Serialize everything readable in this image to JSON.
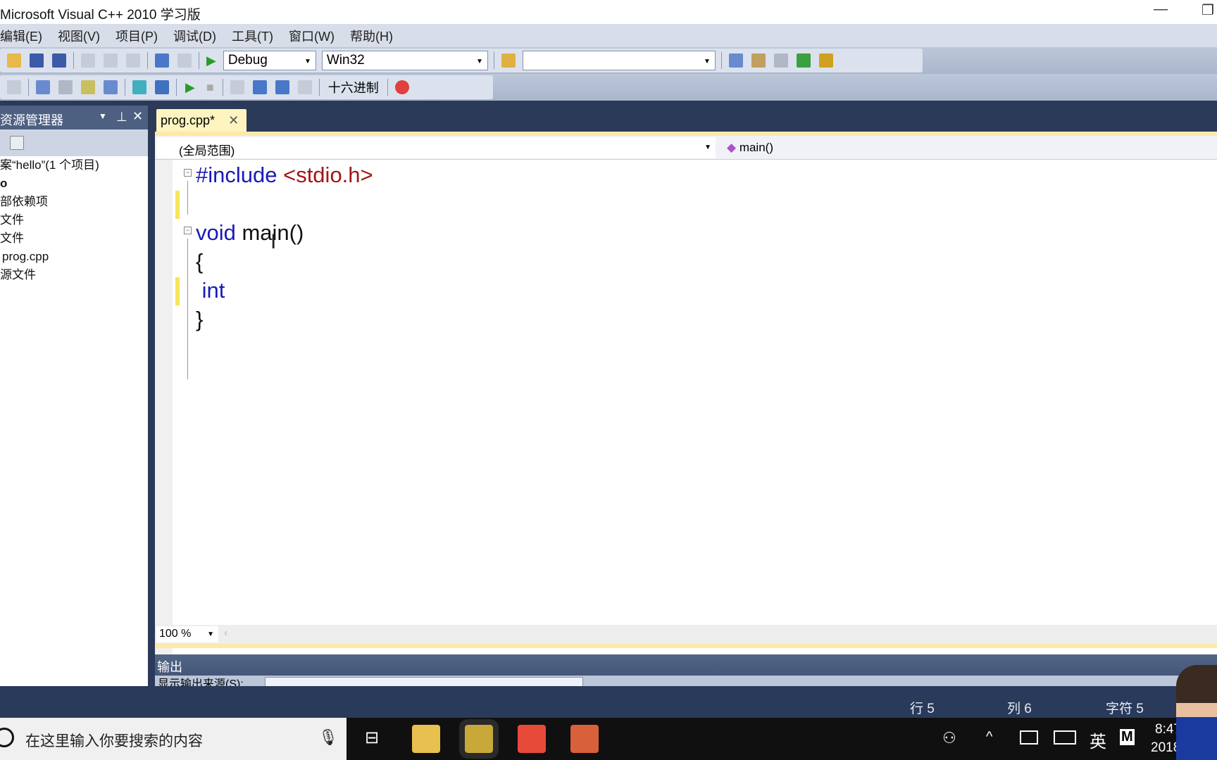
{
  "window": {
    "title": "Microsoft Visual C++ 2010 学习版",
    "minimize": "—",
    "restore": "❐"
  },
  "menu": [
    "编辑(E)",
    "视图(V)",
    "项目(P)",
    "调试(D)",
    "工具(T)",
    "窗口(W)",
    "帮助(H)"
  ],
  "toolbar": {
    "config": "Debug",
    "platform": "Win32",
    "find": "",
    "hex_label": "十六进制"
  },
  "solution_explorer": {
    "title": "资源管理器",
    "items": [
      "案“hello”(1 个项目)",
      "o",
      "部依赖项",
      "文件",
      "文件",
      "prog.cpp",
      "源文件"
    ]
  },
  "editor": {
    "tab": "prog.cpp*",
    "scope": "(全局范围)",
    "function": "main()",
    "lines": [
      {
        "parts": [
          {
            "t": "#include ",
            "c": "kw"
          },
          {
            "t": "<stdio.h>",
            "c": "str"
          }
        ]
      },
      {
        "parts": []
      },
      {
        "parts": [
          {
            "t": "void ",
            "c": "kw"
          },
          {
            "t": "main()",
            "c": "id"
          }
        ]
      },
      {
        "parts": [
          {
            "t": "{",
            "c": "id"
          }
        ]
      },
      {
        "parts": [
          {
            "t": " int",
            "c": "kw"
          }
        ]
      },
      {
        "parts": [
          {
            "t": "}",
            "c": "id"
          }
        ]
      }
    ],
    "zoom": "100 %"
  },
  "output": {
    "title": "输出",
    "source_label": "显示输出来源(S):"
  },
  "status": {
    "line": "行 5",
    "col": "列 6",
    "char": "字符 5"
  },
  "taskbar": {
    "search_placeholder": "在这里输入你要搜索的内容",
    "ime": "英",
    "ime2": "M",
    "time": "8:47",
    "date": "2018"
  },
  "colors": {
    "accent_yellow": "#fde9a8",
    "navy": "#293a5a",
    "keyword": "#1a1ab8",
    "string": "#a31515"
  }
}
